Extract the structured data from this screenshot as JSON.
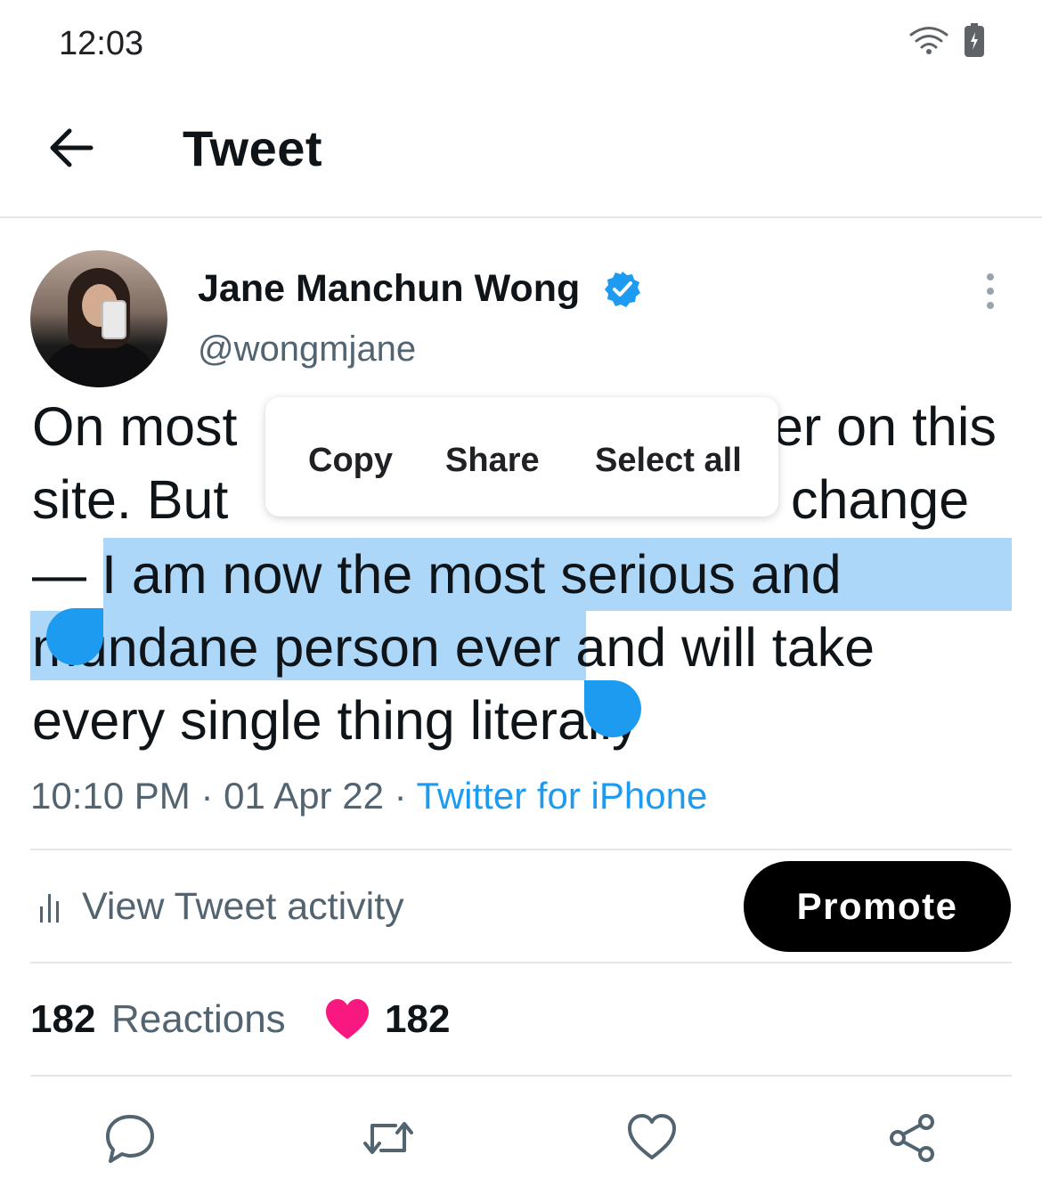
{
  "status_bar": {
    "time": "12:03"
  },
  "header": {
    "title": "Tweet"
  },
  "author": {
    "name": "Jane Manchun Wong",
    "handle": "@wongmjane"
  },
  "tweet": {
    "line1_a": "On most",
    "line1_b": "er on this",
    "line2_a": "site. But",
    "line2_b": "change",
    "line3_dash": "— ",
    "line3_sel": "I am now the most serious and",
    "line4_sel": "mundane person ever",
    "line4_rest": " and will take",
    "line5": "every single thing literally"
  },
  "context_menu": {
    "copy": "Copy",
    "share": "Share",
    "select_all": "Select all"
  },
  "meta": {
    "time": "10:10 PM",
    "date": "01 Apr 22",
    "source": "Twitter for iPhone",
    "sep": " · "
  },
  "activity": {
    "label": "View Tweet activity",
    "promote": "Promote"
  },
  "reactions": {
    "count": "182",
    "label": "Reactions",
    "likes": "182"
  },
  "colors": {
    "accent": "#1d9bf0",
    "selection": "#acd7f8",
    "heart": "#f91880",
    "text": "#0f1419",
    "muted": "#536471"
  },
  "icons": {
    "back": "arrow-left-icon",
    "verified": "verified-badge-icon",
    "more": "more-vertical-icon",
    "reply": "reply-icon",
    "retweet": "retweet-icon",
    "like": "heart-icon",
    "share": "share-icon"
  }
}
